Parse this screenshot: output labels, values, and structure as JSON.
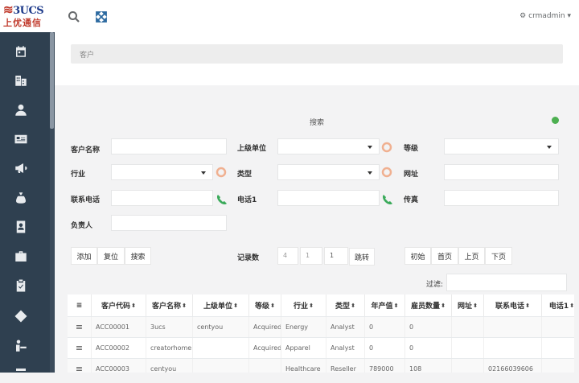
{
  "logo": {
    "text_top": "3UCS",
    "text_bottom": "上优通信"
  },
  "topbar": {
    "user": "crmadmin"
  },
  "breadcrumb": {
    "text": "客户"
  },
  "search": {
    "title": "搜索",
    "labels": {
      "name": "客户名称",
      "parent": "上级单位",
      "level": "等级",
      "industry": "行业",
      "type": "类型",
      "website": "网址",
      "phone": "联系电话",
      "phone1": "电话1",
      "fax": "传真",
      "owner": "负责人"
    }
  },
  "actions": {
    "add": "添加",
    "reset": "复位",
    "search": "搜索"
  },
  "paging": {
    "count_label": "记录数",
    "count": "4",
    "page": "1",
    "goto_value": "1",
    "goto": "跳转",
    "initial": "初始",
    "first": "首页",
    "prev": "上页",
    "next": "下页"
  },
  "filter": {
    "label": "过滤:"
  },
  "table": {
    "columns": [
      "客户代码",
      "客户名称",
      "上级单位",
      "等级",
      "行业",
      "类型",
      "年产值",
      "雇员数量",
      "网址",
      "联系电话",
      "电话1"
    ],
    "rows": [
      [
        "ACC00001",
        "3ucs",
        "centyou",
        "Acquired",
        "Energy",
        "Analyst",
        "0",
        "0",
        "",
        "",
        ""
      ],
      [
        "ACC00002",
        "creatorhome",
        "",
        "Acquired",
        "Apparel",
        "Analyst",
        "0",
        "0",
        "",
        "",
        ""
      ],
      [
        "ACC00003",
        "centyou",
        "",
        "",
        "Healthcare",
        "Reseller",
        "789000",
        "108",
        "",
        "02166039606",
        ""
      ]
    ]
  }
}
